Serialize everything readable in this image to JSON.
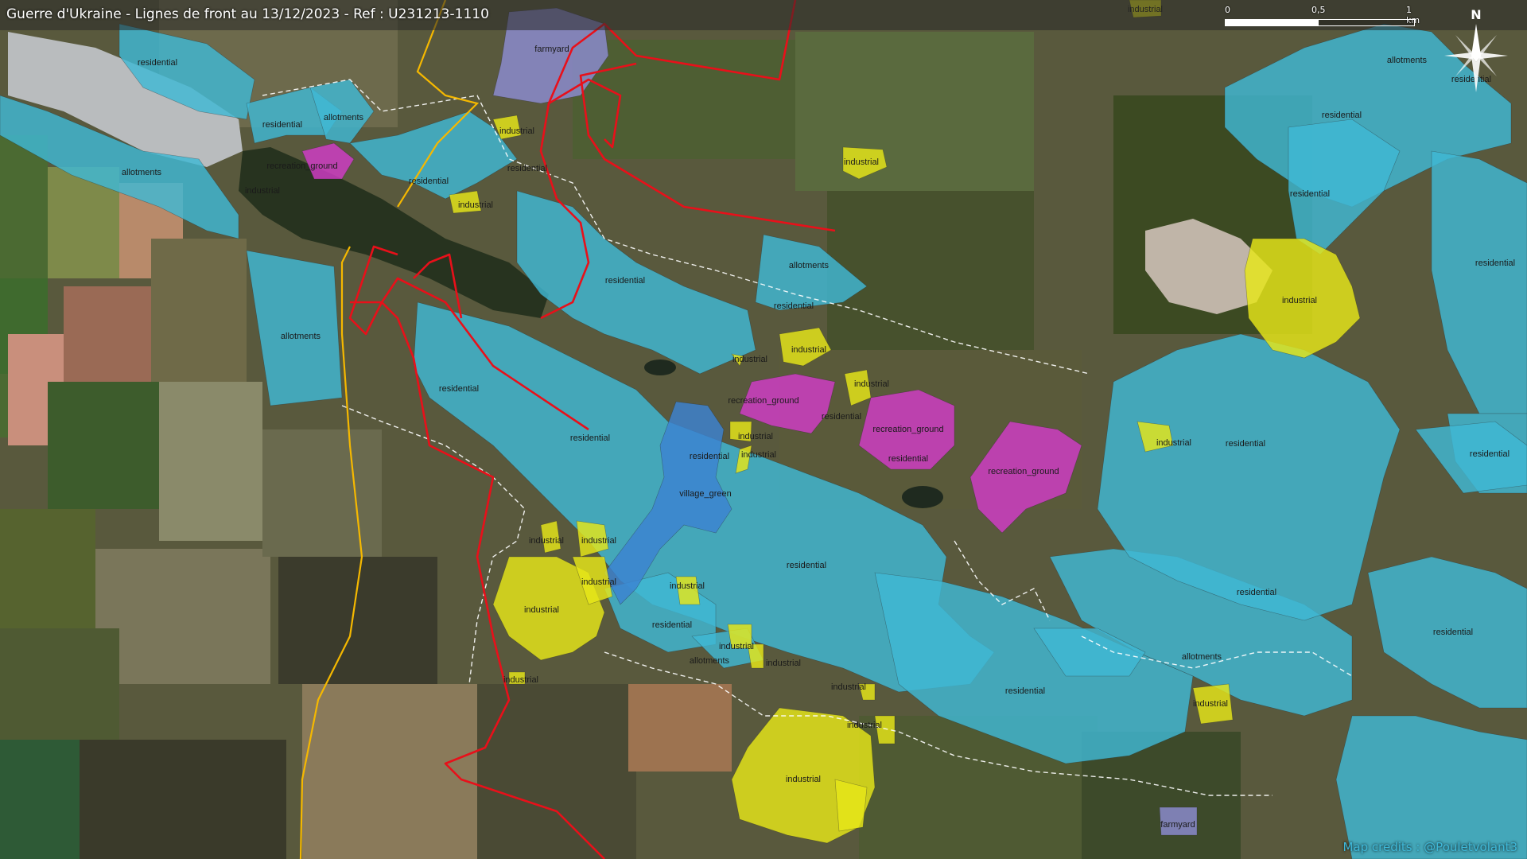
{
  "title": "Guerre d'Ukraine - Lignes de front au 13/12/2023 - Ref : U231213-1110",
  "scale": {
    "ticks": [
      "0",
      "0,5",
      "1 km"
    ]
  },
  "north_label": "N",
  "credits": "Map credits : @Pouletvolant3",
  "colors": {
    "residential": "#3fb8d4",
    "allotments": "#3fb8d4",
    "industrial": "#e6e619",
    "recreation_ground": "#d23cc8",
    "village_green": "#3c82d2",
    "farmyard": "#8c8cd2",
    "front_line": "#e8101a",
    "road": "#f5b800",
    "boundary": "#ffffff"
  },
  "zones": {
    "residential_1": "residential",
    "residential_2": "residential",
    "residential_3": "residential",
    "residential_4": "residential",
    "residential_5": "residential",
    "residential_6": "residential",
    "residential_7": "residential",
    "residential_8": "residential",
    "residential_9": "residential",
    "residential_10": "residential",
    "residential_11": "residential",
    "residential_12": "residential",
    "residential_13": "residential",
    "residential_14": "residential",
    "residential_15": "residential",
    "residential_16": "residential",
    "residential_17": "residential",
    "residential_18": "residential",
    "residential_19": "residential",
    "residential_20": "residential",
    "residential_21": "residential",
    "residential_22": "residential",
    "allotments_1": "allotments",
    "allotments_2": "allotments",
    "allotments_3": "allotments",
    "allotments_4": "allotments",
    "allotments_5": "allotments",
    "allotments_6": "allotments",
    "allotments_7": "allotments",
    "industrial_1": "industrial",
    "industrial_2": "industrial",
    "industrial_3": "industrial",
    "industrial_4": "industrial",
    "industrial_5": "industrial",
    "industrial_6": "industrial",
    "industrial_7": "industrial",
    "industrial_8": "industrial",
    "industrial_9": "industrial",
    "industrial_10": "industrial",
    "industrial_11": "industrial",
    "industrial_12": "industrial",
    "industrial_13": "industrial",
    "industrial_14": "industrial",
    "industrial_15": "industrial",
    "industrial_16": "industrial",
    "industrial_17": "industrial",
    "industrial_18": "industrial",
    "industrial_19": "industrial",
    "industrial_20": "industrial",
    "industrial_21": "industrial",
    "industrial_22": "industrial",
    "industrial_23": "industrial",
    "industrial_24": "industrial",
    "recreation_1": "recreation_ground",
    "recreation_2": "recreation_ground",
    "recreation_3": "recreation_ground",
    "recreation_4": "recreation_ground",
    "village_green_1": "village_green",
    "farmyard_1": "farmyard",
    "farmyard_2": "farmyard"
  }
}
